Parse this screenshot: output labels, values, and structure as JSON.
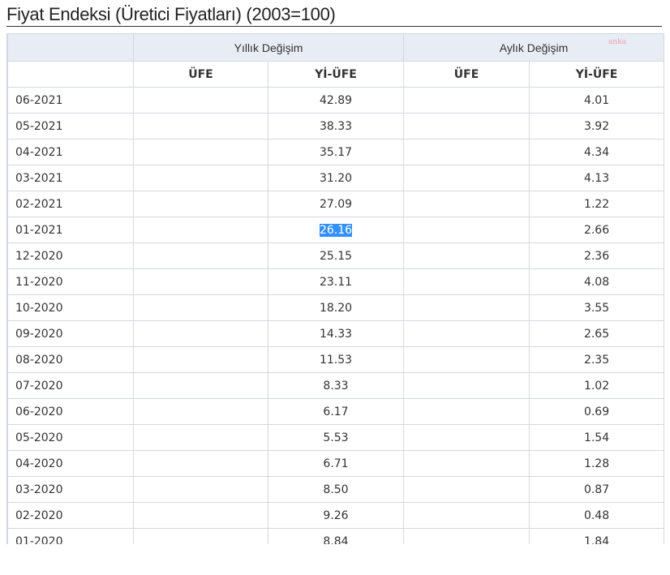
{
  "title": "Fiyat Endeksi (Üretici Fiyatları) (2003=100)",
  "watermark": "anka",
  "table": {
    "group_headers": [
      "",
      "Yıllık Değişim",
      "Aylık Değişim"
    ],
    "sub_headers": [
      "",
      "ÜFE",
      "Yİ-ÜFE",
      "ÜFE",
      "Yİ-ÜFE"
    ],
    "rows": [
      {
        "date": "06-2021",
        "annual_ufe": "",
        "annual_yiufe": "42.89",
        "monthly_ufe": "",
        "monthly_yiufe": "4.01"
      },
      {
        "date": "05-2021",
        "annual_ufe": "",
        "annual_yiufe": "38.33",
        "monthly_ufe": "",
        "monthly_yiufe": "3.92"
      },
      {
        "date": "04-2021",
        "annual_ufe": "",
        "annual_yiufe": "35.17",
        "monthly_ufe": "",
        "monthly_yiufe": "4.34"
      },
      {
        "date": "03-2021",
        "annual_ufe": "",
        "annual_yiufe": "31.20",
        "monthly_ufe": "",
        "monthly_yiufe": "4.13"
      },
      {
        "date": "02-2021",
        "annual_ufe": "",
        "annual_yiufe": "27.09",
        "monthly_ufe": "",
        "monthly_yiufe": "1.22"
      },
      {
        "date": "01-2021",
        "annual_ufe": "",
        "annual_yiufe": "26.16",
        "monthly_ufe": "",
        "monthly_yiufe": "2.66",
        "selected": true
      },
      {
        "date": "12-2020",
        "annual_ufe": "",
        "annual_yiufe": "25.15",
        "monthly_ufe": "",
        "monthly_yiufe": "2.36"
      },
      {
        "date": "11-2020",
        "annual_ufe": "",
        "annual_yiufe": "23.11",
        "monthly_ufe": "",
        "monthly_yiufe": "4.08"
      },
      {
        "date": "10-2020",
        "annual_ufe": "",
        "annual_yiufe": "18.20",
        "monthly_ufe": "",
        "monthly_yiufe": "3.55"
      },
      {
        "date": "09-2020",
        "annual_ufe": "",
        "annual_yiufe": "14.33",
        "monthly_ufe": "",
        "monthly_yiufe": "2.65"
      },
      {
        "date": "08-2020",
        "annual_ufe": "",
        "annual_yiufe": "11.53",
        "monthly_ufe": "",
        "monthly_yiufe": "2.35"
      },
      {
        "date": "07-2020",
        "annual_ufe": "",
        "annual_yiufe": "8.33",
        "monthly_ufe": "",
        "monthly_yiufe": "1.02"
      },
      {
        "date": "06-2020",
        "annual_ufe": "",
        "annual_yiufe": "6.17",
        "monthly_ufe": "",
        "monthly_yiufe": "0.69"
      },
      {
        "date": "05-2020",
        "annual_ufe": "",
        "annual_yiufe": "5.53",
        "monthly_ufe": "",
        "monthly_yiufe": "1.54"
      },
      {
        "date": "04-2020",
        "annual_ufe": "",
        "annual_yiufe": "6.71",
        "monthly_ufe": "",
        "monthly_yiufe": "1.28"
      },
      {
        "date": "03-2020",
        "annual_ufe": "",
        "annual_yiufe": "8.50",
        "monthly_ufe": "",
        "monthly_yiufe": "0.87"
      },
      {
        "date": "02-2020",
        "annual_ufe": "",
        "annual_yiufe": "9.26",
        "monthly_ufe": "",
        "monthly_yiufe": "0.48"
      },
      {
        "date": "01-2020",
        "annual_ufe": "",
        "annual_yiufe": "8.84",
        "monthly_ufe": "",
        "monthly_yiufe": "1.84"
      }
    ]
  },
  "colors": {
    "header_bg": "#e8edf5",
    "border": "#d4d8dd",
    "selection": "#3390ff"
  }
}
